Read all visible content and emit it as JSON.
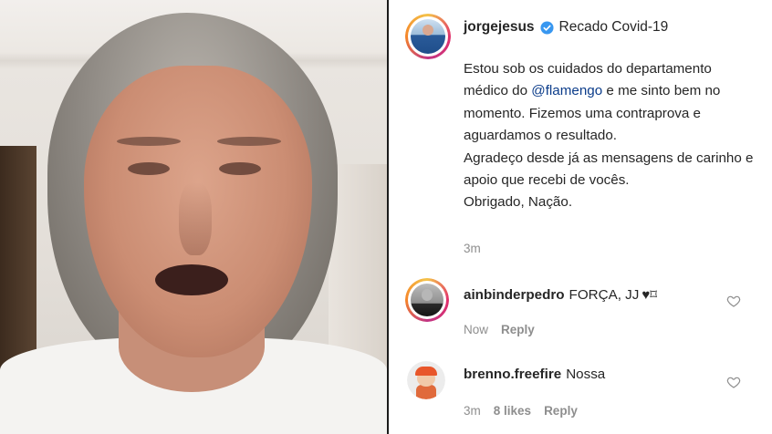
{
  "post": {
    "username": "jorgejesus",
    "header_title": "Recado Covid-19",
    "caption": {
      "line1_pre": "Estou sob os cuidados do departamento médico do ",
      "mention": "@flamengo",
      "line1_post": " e me sinto bem no momento. Fizemos uma contraprova e aguardamos o resultado.",
      "line2": "Agradeço desde já as mensagens de carinho e apoio que recebi de vocês.",
      "line3": "Obrigado, Nação."
    },
    "time": "3m"
  },
  "comments": [
    {
      "username": "ainbinderpedro",
      "text": "FORÇA, JJ",
      "emoji": "♥⌑",
      "time": "Now",
      "likes": "",
      "reply_label": "Reply"
    },
    {
      "username": "brenno.freefire",
      "text": "Nossa",
      "emoji": "",
      "time": "3m",
      "likes": "8 likes",
      "reply_label": "Reply"
    }
  ],
  "colors": {
    "text": "#262626",
    "muted": "#8e8e8e",
    "mention": "#0b3c8a",
    "verified": "#3897f0"
  },
  "icons": {
    "verified": "verified-badge-icon",
    "like": "heart-outline-icon"
  }
}
